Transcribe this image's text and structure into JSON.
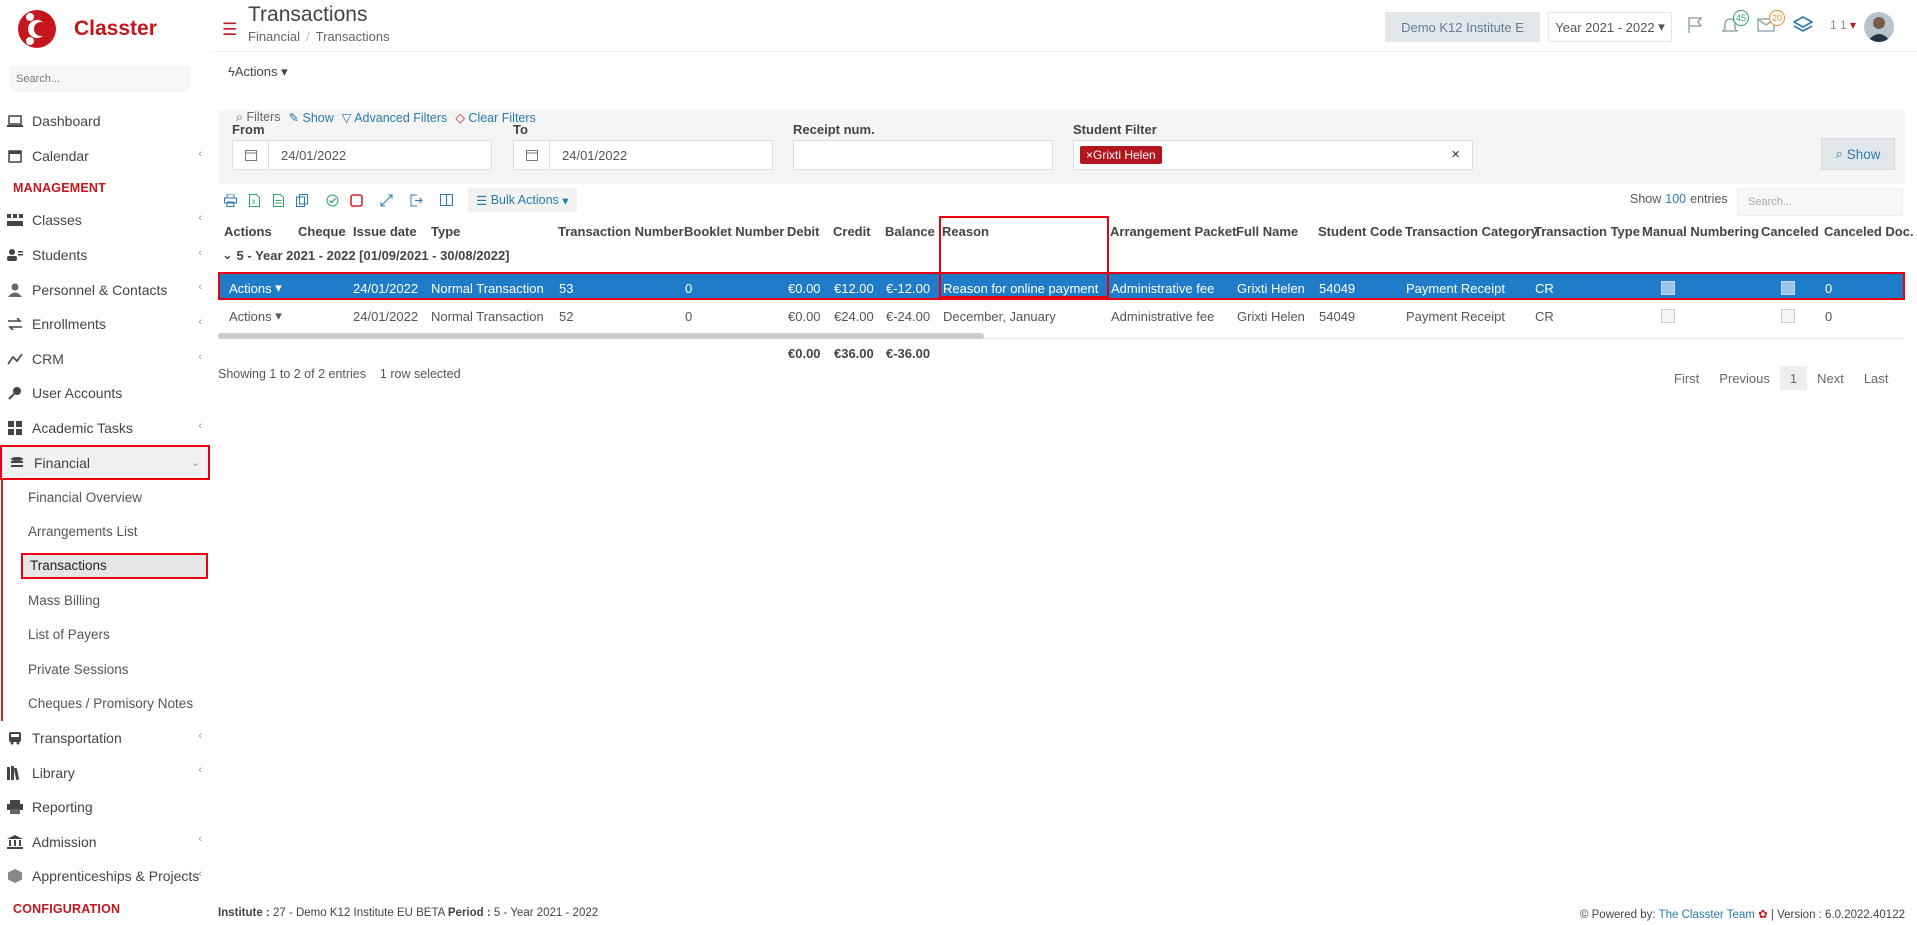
{
  "brand": {
    "name": "Classter"
  },
  "sidebar": {
    "search_placeholder": "Search...",
    "top_items": [
      {
        "label": "Dashboard",
        "icon": "laptop-icon"
      },
      {
        "label": "Calendar",
        "icon": "calendar-icon"
      }
    ],
    "management_head": "MANAGEMENT",
    "management_items": [
      {
        "label": "Classes",
        "icon": "classes-icon"
      },
      {
        "label": "Students",
        "icon": "students-icon"
      },
      {
        "label": "Personnel & Contacts",
        "icon": "personnel-icon"
      },
      {
        "label": "Enrollments",
        "icon": "enrollments-icon"
      },
      {
        "label": "CRM",
        "icon": "crm-icon"
      },
      {
        "label": "User Accounts",
        "icon": "key-icon"
      },
      {
        "label": "Academic Tasks",
        "icon": "tasks-icon"
      }
    ],
    "financial": {
      "label": "Financial"
    },
    "financial_sub": [
      "Financial Overview",
      "Arrangements List",
      "Transactions",
      "Mass Billing",
      "List of Payers",
      "Private Sessions",
      "Cheques / Promisory Notes"
    ],
    "bottom_items": [
      {
        "label": "Transportation"
      },
      {
        "label": "Library"
      },
      {
        "label": "Reporting"
      },
      {
        "label": "Admission"
      },
      {
        "label": "Apprenticeships & Projects"
      }
    ],
    "configuration_head": "CONFIGURATION"
  },
  "header": {
    "title": "Transactions",
    "breadcrumb": [
      "Financial",
      "Transactions"
    ],
    "institute": "Demo K12 Institute E",
    "year": "Year 2021 - 2022",
    "notifications_count": "45",
    "messages_count": "20",
    "user_count": "1 1"
  },
  "actions": {
    "label": "Actions"
  },
  "filters": {
    "filters_label": "Filters",
    "show_link": "Show",
    "advanced_link": "Advanced Filters",
    "clear_link": "Clear Filters",
    "from_label": "From",
    "from_value": "24/01/2022",
    "to_label": "To",
    "to_value": "24/01/2022",
    "receipt_label": "Receipt num.",
    "student_label": "Student Filter",
    "student_tag": "Grixti Helen",
    "show_button": "Show"
  },
  "toolbar": {
    "bulk_actions": "Bulk Actions",
    "show_label": "Show",
    "entries_count": "100",
    "entries_label": "entries",
    "search_placeholder": "Search..."
  },
  "table": {
    "columns": [
      "Actions",
      "Cheque",
      "Issue date",
      "Type",
      "Transaction Number",
      "Booklet Number",
      "Debit",
      "Credit",
      "Balance",
      "Reason",
      "Arrangement Packet",
      "Full Name",
      "Student Code",
      "Transaction Category",
      "Transaction Type",
      "Manual Numbering",
      "Canceled",
      "Canceled Doc."
    ],
    "group": "5 - Year 2021 - 2022 [01/09/2021 - 30/08/2022]",
    "rows": [
      {
        "actions": "Actions",
        "issue_date": "24/01/2022",
        "type": "Normal Transaction",
        "number": "53",
        "booklet": "0",
        "debit": "€0.00",
        "credit": "€12.00",
        "balance": "€-12.00",
        "reason": "Reason for online payment",
        "packet": "Administrative fee",
        "full_name": "Grixti Helen",
        "code": "54049",
        "category": "Payment Receipt",
        "ttype": "CR",
        "canceled_doc": "0"
      },
      {
        "actions": "Actions",
        "issue_date": "24/01/2022",
        "type": "Normal Transaction",
        "number": "52",
        "booklet": "0",
        "debit": "€0.00",
        "credit": "€24.00",
        "balance": "€-24.00",
        "reason": "December, January",
        "packet": "Administrative fee",
        "full_name": "Grixti Helen",
        "code": "54049",
        "category": "Payment Receipt",
        "ttype": "CR",
        "canceled_doc": "0"
      }
    ],
    "totals": {
      "debit": "€0.00",
      "credit": "€36.00",
      "balance": "€-36.00"
    },
    "info": "Showing 1 to 2 of 2 entries",
    "selected": "1 row selected"
  },
  "pager": {
    "first": "First",
    "previous": "Previous",
    "current": "1",
    "next": "Next",
    "last": "Last"
  },
  "footer": {
    "institute_label": "Institute :",
    "institute_value": "27 - Demo K12 Institute EU BETA",
    "period_label": "Period :",
    "period_value": "5 - Year 2021 - 2022",
    "powered_by": "Powered by:",
    "team": "The Classter Team",
    "version": "| Version : 6.0.2022.40122"
  },
  "colors": {
    "brand_red": "#c4161c",
    "link_blue": "#2a7ab0",
    "selected_row": "#1e7cc9",
    "highlight": "#e60012"
  }
}
